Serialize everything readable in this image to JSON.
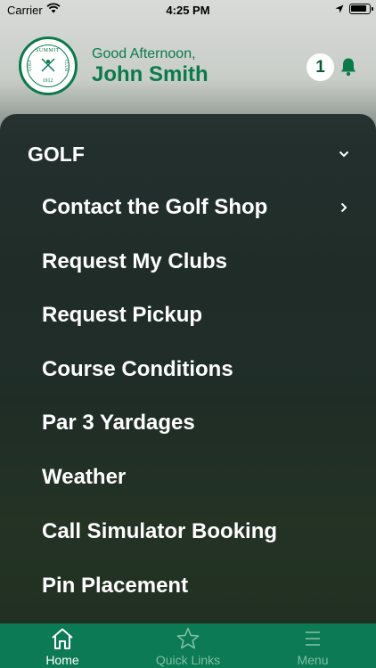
{
  "status_bar": {
    "carrier": "Carrier",
    "time": "4:25 PM"
  },
  "header": {
    "greeting": "Good Afternoon,",
    "user_name": "John Smith",
    "notification_count": "1",
    "logo": {
      "top_text": "SUMMIT",
      "left_text": "GOLF",
      "right_text": "CLUB",
      "year": "1912"
    }
  },
  "colors": {
    "brand_green": "#0b7a4b",
    "tab_bar": "#0b7a55"
  },
  "menu": {
    "section_title": "GOLF",
    "items": [
      {
        "label": "Contact the Golf Shop",
        "has_chevron": true
      },
      {
        "label": "Request My Clubs"
      },
      {
        "label": "Request Pickup"
      },
      {
        "label": "Course Conditions"
      },
      {
        "label": "Par 3 Yardages"
      },
      {
        "label": "Weather"
      },
      {
        "label": "Call Simulator Booking"
      },
      {
        "label": "Pin Placement"
      }
    ]
  },
  "tabs": [
    {
      "label": "Home",
      "icon": "home-icon",
      "active": true
    },
    {
      "label": "Quick Links",
      "icon": "star-icon",
      "active": false
    },
    {
      "label": "Menu",
      "icon": "menu-icon",
      "active": false
    }
  ]
}
